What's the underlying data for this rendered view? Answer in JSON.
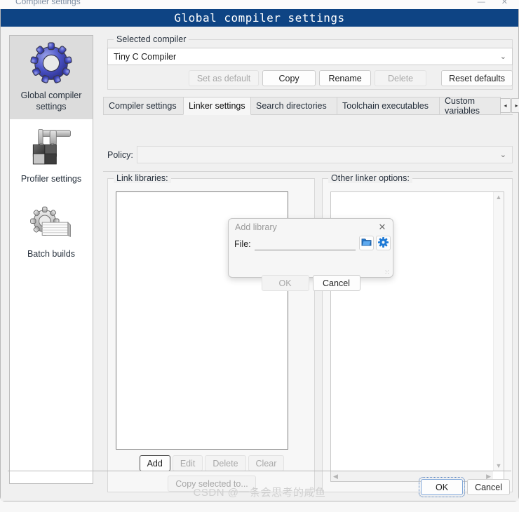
{
  "background_window": {
    "title": "Compiler settings",
    "buttons": "—  ✕"
  },
  "window": {
    "title": "Global compiler settings"
  },
  "sidebar": {
    "items": [
      {
        "label": "Global compiler settings",
        "icon": "gear-icon",
        "selected": true
      },
      {
        "label": "Profiler settings",
        "icon": "caliper-icon",
        "selected": false
      },
      {
        "label": "Batch builds",
        "icon": "gear-stack-icon",
        "selected": false
      }
    ]
  },
  "selected_compiler": {
    "group_title": "Selected compiler",
    "value": "Tiny C Compiler",
    "chevron": "⌄",
    "buttons": [
      {
        "label": "Set as default",
        "enabled": false
      },
      {
        "label": "Copy",
        "enabled": true
      },
      {
        "label": "Rename",
        "enabled": true
      },
      {
        "label": "Delete",
        "enabled": false
      },
      {
        "label": "Reset defaults",
        "enabled": true
      }
    ]
  },
  "tabs": {
    "items": [
      {
        "label": "Compiler settings",
        "active": false
      },
      {
        "label": "Linker settings",
        "active": true
      },
      {
        "label": "Search directories",
        "active": false
      },
      {
        "label": "Toolchain executables",
        "active": false
      },
      {
        "label": "Custom variables",
        "active": false
      }
    ],
    "scroll_left": "◂",
    "scroll_right": "▸"
  },
  "policy": {
    "label": "Policy:",
    "value": "",
    "chevron": "⌄"
  },
  "link_libraries": {
    "group_title": "Link libraries:",
    "items": [],
    "buttons": [
      {
        "label": "Add",
        "enabled": true,
        "focused": true
      },
      {
        "label": "Edit",
        "enabled": false,
        "focused": false
      },
      {
        "label": "Delete",
        "enabled": false,
        "focused": false
      },
      {
        "label": "Clear",
        "enabled": false,
        "focused": false
      }
    ],
    "copy_button": {
      "label": "Copy selected to...",
      "enabled": false
    }
  },
  "move_arrows": {
    "up": {
      "name": "move-up-arrow"
    },
    "down": {
      "name": "move-down-arrow"
    }
  },
  "other_linker_options": {
    "group_title": "Other linker options:",
    "value": "",
    "scroll_up": "▲",
    "scroll_down": "▼",
    "scroll_left": "◀",
    "scroll_right": "▶"
  },
  "footer": {
    "buttons": [
      {
        "label": "OK",
        "enabled": true,
        "focused": true
      },
      {
        "label": "Cancel",
        "enabled": true,
        "focused": false
      }
    ]
  },
  "add_library_dialog": {
    "title": "Add library",
    "close": "✕",
    "file_label": "File:",
    "file_value": "",
    "file_placeholder": "",
    "browse_icon": "folder-open-icon",
    "settings_icon": "gear-icon",
    "buttons": [
      {
        "label": "OK",
        "enabled": false
      },
      {
        "label": "Cancel",
        "enabled": true
      }
    ],
    "grip": "⁙"
  },
  "watermark": {
    "text": "CSDN @一条会思考的咸鱼"
  },
  "colors": {
    "titlebar": "#0e4484",
    "accent_blue": "#1e7ad6",
    "arrow_green": "#8fc98f",
    "window_bg": "#f0f0f0"
  }
}
